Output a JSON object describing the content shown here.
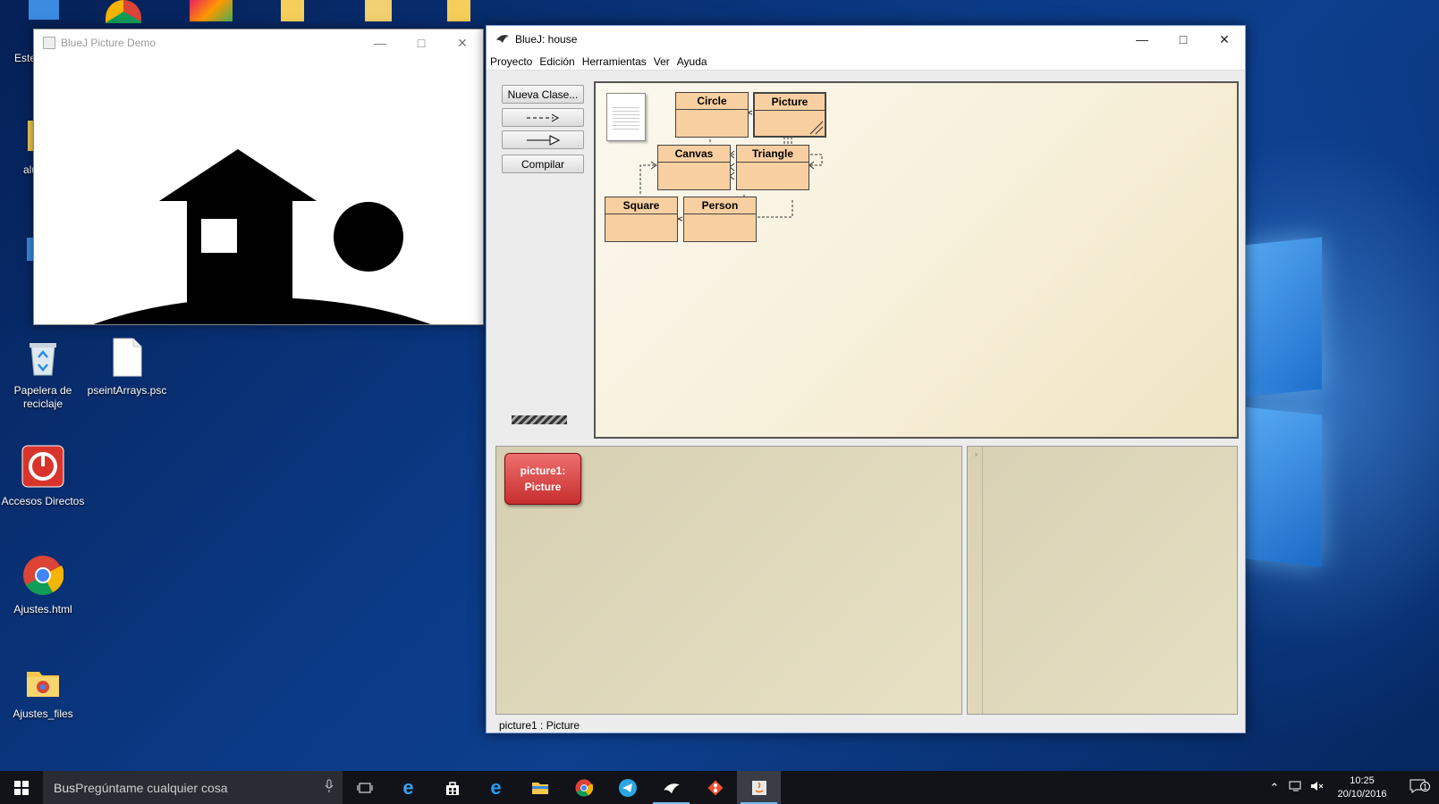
{
  "desktop": {
    "icons": [
      {
        "label": "Papelera de reciclaje",
        "icon": "recycle-bin-icon"
      },
      {
        "label": "pseintArrays.psc",
        "icon": "file-icon"
      },
      {
        "label": "Accesos Directos",
        "icon": "power-icon"
      },
      {
        "label": "Ajustes.html",
        "icon": "chrome-icon"
      },
      {
        "label": "Ajustes_files",
        "icon": "folder-icon"
      }
    ],
    "partial_labels": [
      "Este",
      "alu"
    ]
  },
  "demo_window": {
    "title": "BlueJ Picture Demo"
  },
  "bluej": {
    "title": "BlueJ:  house",
    "menu": [
      "Proyecto",
      "Edición",
      "Herramientas",
      "Ver",
      "Ayuda"
    ],
    "tools": {
      "new_class": "Nueva Clase...",
      "dep_arrow": "- - ->",
      "inh_arrow": "——▷",
      "compile": "Compilar"
    },
    "classes": [
      "Circle",
      "Picture",
      "Canvas",
      "Triangle",
      "Square",
      "Person"
    ],
    "object": {
      "line1": "picture1:",
      "line2": "Picture"
    },
    "status": "picture1 : Picture"
  },
  "taskbar": {
    "search_prefix": "Bus",
    "search_placeholder": "Pregúntame cualquier cosa",
    "time": "10:25",
    "date": "20/10/2016",
    "notif_count": "1"
  },
  "colors": {
    "class_fill": "#f8cfa0",
    "object_fill": "#d83a3a",
    "accent": "#76b9ed"
  }
}
